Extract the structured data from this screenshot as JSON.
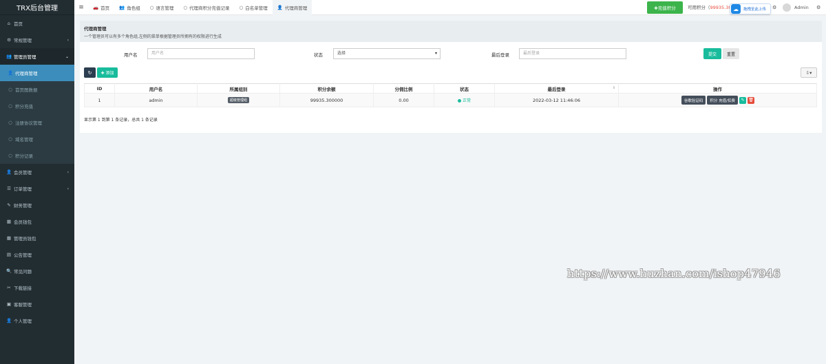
{
  "app": {
    "title": "TRX后台管理"
  },
  "sidebar": {
    "items": [
      {
        "icon": "⌂",
        "label": "首页",
        "arrow": ""
      },
      {
        "icon": "⚙",
        "label": "常规管理",
        "arrow": "‹"
      },
      {
        "icon": "👥",
        "label": "管理员管理",
        "arrow": "⌄"
      },
      {
        "icon": "👤",
        "label": "代理商管理",
        "arrow": ""
      },
      {
        "icon": "○",
        "label": "首页图数据",
        "arrow": ""
      },
      {
        "icon": "○",
        "label": "积分充值",
        "arrow": ""
      },
      {
        "icon": "○",
        "label": "注册协议管理",
        "arrow": ""
      },
      {
        "icon": "○",
        "label": "域名管理",
        "arrow": ""
      },
      {
        "icon": "○",
        "label": "积分记录",
        "arrow": ""
      },
      {
        "icon": "👤",
        "label": "会员管理",
        "arrow": "‹"
      },
      {
        "icon": "☰",
        "label": "订单管理",
        "arrow": "‹"
      },
      {
        "icon": "✎",
        "label": "财务管理",
        "arrow": ""
      },
      {
        "icon": "▦",
        "label": "会员钱包",
        "arrow": ""
      },
      {
        "icon": "▦",
        "label": "管理员钱包",
        "arrow": ""
      },
      {
        "icon": "▤",
        "label": "公告管理",
        "arrow": ""
      },
      {
        "icon": "🔍",
        "label": "常见问题",
        "arrow": ""
      },
      {
        "icon": "✂",
        "label": "下载链接",
        "arrow": ""
      },
      {
        "icon": "▣",
        "label": "客服管理",
        "arrow": ""
      },
      {
        "icon": "👤",
        "label": "个人管理",
        "arrow": ""
      }
    ]
  },
  "topbar": {
    "tabs": [
      {
        "icon": "🚗",
        "label": "首页"
      },
      {
        "icon": "👥",
        "label": "角色组"
      },
      {
        "icon": "○",
        "label": "语言管理"
      },
      {
        "icon": "○",
        "label": "代理商积分充值记录"
      },
      {
        "icon": "○",
        "label": "白名单管理"
      },
      {
        "icon": "👤",
        "label": "代理商管理"
      }
    ],
    "recharge_label": "✚充值积分",
    "points_label": "可用积分（",
    "points_value": "99935.30",
    "upload_label": "拖拽至此上传",
    "admin_name": "Admin"
  },
  "panel": {
    "title": "代理商管理",
    "description": "一个管理员可以有多个角色组,左侧的菜单根据管理员所拥有的权限进行生成"
  },
  "search": {
    "username_label": "用户名",
    "username_placeholder": "用户名",
    "status_label": "状态",
    "status_value": "选择",
    "last_login_label": "最后登录",
    "last_login_placeholder": "最后登录",
    "submit_label": "提交",
    "reset_label": "重置"
  },
  "toolbar": {
    "refresh_icon": "↻",
    "add_label": "✚ 添加",
    "export_icon": "⇩▾"
  },
  "table": {
    "columns": [
      "ID",
      "用户名",
      "所属组别",
      "积分余额",
      "分佣比例",
      "状态",
      "最后登录",
      "操作"
    ],
    "rows": [
      {
        "id": "1",
        "username": "admin",
        "group": "超级管理组",
        "balance": "99935.300000",
        "ratio": "0.00",
        "status": "正常",
        "last_login": "2022-03-12 11:46:06",
        "op_verify": "谷歌验证码",
        "op_points": "积分 充值/扣费"
      }
    ]
  },
  "pager": {
    "text": "显示第 1 到第 1 条记录，总共 1 条记录"
  },
  "watermark": {
    "text": "https://www.huzhan.com/ishop47946"
  },
  "colors": {
    "sidebar_bg": "#222d32",
    "active": "#3c8dbc",
    "accent": "#18bc9c",
    "danger": "#e74c3c",
    "recharge": "#3cb44b"
  }
}
